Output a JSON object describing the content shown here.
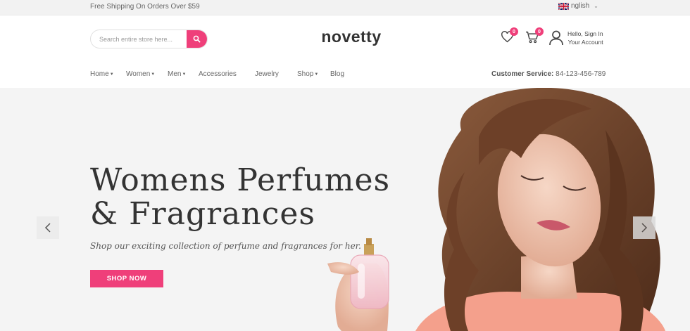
{
  "topbar": {
    "shipping_text": "Free Shipping On Orders Over $59",
    "language": "English",
    "language_visible": "nglish"
  },
  "header": {
    "search": {
      "placeholder": "Search entire store here..."
    },
    "logo": "novetty",
    "wishlist_count": "0",
    "cart_count": "0",
    "account": {
      "line1": "Hello, Sign In",
      "line2": "Your Account"
    }
  },
  "nav": {
    "items": [
      {
        "label": "Home",
        "dropdown": true
      },
      {
        "label": "Women",
        "dropdown": true
      },
      {
        "label": "Men",
        "dropdown": true
      },
      {
        "label": "Accessories",
        "dropdown": false
      },
      {
        "label": "Jewelry",
        "dropdown": false
      },
      {
        "label": "Shop",
        "dropdown": true
      },
      {
        "label": "Blog",
        "dropdown": false
      }
    ],
    "customer_service_label": "Customer Service:",
    "customer_service_phone": "84-123-456-789"
  },
  "hero": {
    "title_line1": "Womens Perfumes",
    "title_line2": "& Fragrances",
    "subtitle": "Shop our exciting collection of perfume and fragrances for her.",
    "button_label": "SHOP NOW"
  },
  "icons": {
    "search": "search-icon",
    "wishlist": "heart-icon",
    "cart": "cart-icon",
    "account": "user-icon",
    "prev": "chevron-left-icon",
    "next": "chevron-right-icon",
    "flag": "uk-flag-icon"
  },
  "colors": {
    "accent": "#ef3f7a",
    "topbar_bg": "#f2f2f2",
    "hero_bg": "#f4f4f4",
    "text_dark": "#333333"
  }
}
